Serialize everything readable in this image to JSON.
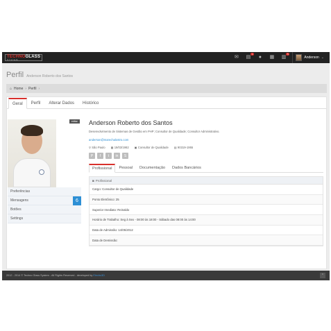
{
  "topbar": {
    "logo_main_prefix": "TECHNO",
    "logo_main_suffix": "GLASS",
    "logo_sub": "SYSTEM",
    "icons": [
      {
        "name": "comments-icon",
        "glyph": "✉",
        "badge": ""
      },
      {
        "name": "notifications-icon",
        "glyph": "▤",
        "badge": "1"
      },
      {
        "name": "globe-icon",
        "glyph": "●",
        "badge": ""
      },
      {
        "name": "calendar-icon",
        "glyph": "▦",
        "badge": ""
      },
      {
        "name": "tasks-icon",
        "glyph": "▥",
        "badge": "5"
      }
    ],
    "user_name": "Anderson"
  },
  "page": {
    "title": "Perfil",
    "subtitle": "Anderson Roberto dos Santos"
  },
  "breadcrumb": {
    "home": "Home",
    "current": "Perfil"
  },
  "tabs": [
    "Geral",
    "Perfil",
    "Alterar Dados",
    "Histórico"
  ],
  "profile": {
    "edit_label": "editar",
    "name": "Anderson Roberto dos Santos",
    "description": "Desenvolvimento de Sistemas de Gestão em PHP; Consultor de Qualidade; Consultor Administrativo.",
    "email": "anderson@marechalostro.com",
    "city": "São Paulo",
    "birthdate": "19/03/1982",
    "role": "Consultor de Qualidade",
    "id": "90319-1955"
  },
  "side_menu": [
    {
      "label": "Preferências",
      "count": ""
    },
    {
      "label": "Mensagens",
      "count": "6"
    },
    {
      "label": "Botões",
      "count": ""
    },
    {
      "label": "Settings",
      "count": ""
    }
  ],
  "subtabs": [
    "Profissional",
    "Pessoal",
    "Documentação",
    "Dados Bancários"
  ],
  "info": {
    "header": "Profissional",
    "rows": [
      "Cargo: Consultor de Qualidade",
      "Ponto Eletrônico: 25",
      "Superior Imediato: Reinaldo",
      "Horário de Trabalho: Seg à Sex - 08:00 às 18:00 - Sábado das 08:00 às 14:00",
      "Data de Admissão: 14/05/2012",
      "Data de Demissão:"
    ]
  },
  "footer": {
    "copyright": "2012 - 2014 © Techno Glass System - All Rights Reserved - developed by",
    "developer": "Electro3D"
  },
  "colors": {
    "accent": "#d8302c",
    "topbar": "#222222",
    "footer": "#3a3a3a",
    "link": "#2d8fd5"
  }
}
